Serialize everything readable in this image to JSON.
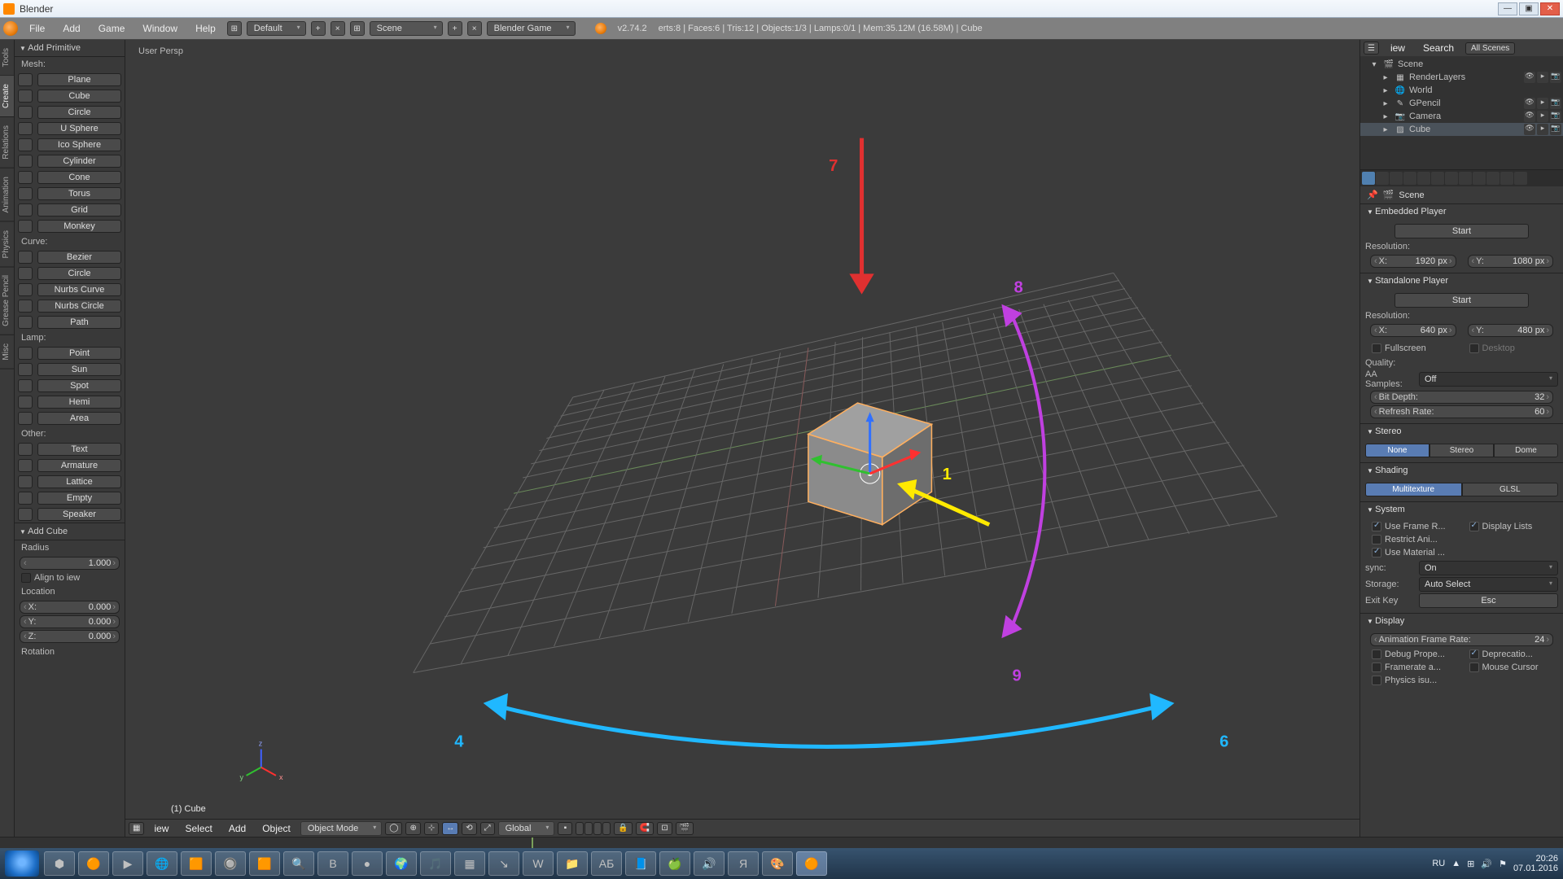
{
  "window": {
    "title": "Blender",
    "min": "—",
    "max": "▣",
    "close": "✕"
  },
  "header": {
    "menus": [
      "File",
      "Add",
      "Game",
      "Window",
      "Help"
    ],
    "layout": "Default",
    "scene": "Scene",
    "engine": "Blender Game",
    "version": "v2.74.2",
    "stats": "erts:8 | Faces:6 | Tris:12 | Objects:1/3 | Lamps:0/1 | Mem:35.12M (16.58M) | Cube"
  },
  "vtabs": [
    "Tools",
    "Create",
    "Relations",
    "Animation",
    "Physics",
    "Grease Pencil",
    "Misc"
  ],
  "toolshelf": {
    "title": "Add Primitive",
    "groups": [
      {
        "label": "Mesh:",
        "items": [
          "Plane",
          "Cube",
          "Circle",
          "U   Sphere",
          "Ico Sphere",
          "Cylinder",
          "Cone",
          "Torus",
          "Grid",
          "Monkey"
        ]
      },
      {
        "label": "Curve:",
        "items": [
          "Bezier",
          "Circle",
          "Nurbs Curve",
          "Nurbs Circle",
          "Path"
        ]
      },
      {
        "label": "Lamp:",
        "items": [
          "Point",
          "Sun",
          "Spot",
          "Hemi",
          "Area"
        ]
      },
      {
        "label": "Other:",
        "items": [
          "Text",
          "Armature",
          "Lattice",
          "Empty",
          "Speaker"
        ]
      }
    ],
    "operator": {
      "title": "Add Cube",
      "radius_l": "Radius",
      "radius_v": "1.000",
      "align": "Align to   iew",
      "loc_l": "Location",
      "x_l": "X:",
      "x_v": "0.000",
      "y_l": "Y:",
      "y_v": "0.000",
      "z_l": "Z:",
      "z_v": "0.000",
      "rot_l": "Rotation"
    }
  },
  "viewport": {
    "persp": "User Persp",
    "obj": "(1) Cube",
    "mode": "Object Mode",
    "orient": "Global",
    "menus": [
      "iew",
      "Select",
      "Add",
      "Object"
    ],
    "annotations": {
      "a1": "1",
      "a4": "4",
      "a6": "6",
      "a7": "7",
      "a8": "8",
      "a9": "9"
    }
  },
  "outliner": {
    "head": [
      "iew",
      "Search",
      "All Scenes"
    ],
    "rows": [
      {
        "ind": 0,
        "icon": "🎬",
        "name": "Scene",
        "sel": false,
        "toggles": false
      },
      {
        "ind": 1,
        "icon": "▦",
        "name": "RenderLayers",
        "sel": false,
        "toggles": true
      },
      {
        "ind": 1,
        "icon": "🌐",
        "name": "World",
        "sel": false,
        "toggles": false
      },
      {
        "ind": 1,
        "icon": "✎",
        "name": "GPencil",
        "sel": false,
        "toggles": true
      },
      {
        "ind": 1,
        "icon": "📷",
        "name": "Camera",
        "sel": false,
        "toggles": true
      },
      {
        "ind": 1,
        "icon": "▨",
        "name": "Cube",
        "sel": true,
        "toggles": true
      }
    ]
  },
  "props": {
    "breadcrumb": "Scene",
    "embedded_t": "Embedded Player",
    "start": "Start",
    "res_l": "Resolution:",
    "ex_l": "X:",
    "ex_v": "1920 px",
    "ey_l": "Y:",
    "ey_v": "1080 px",
    "standalone_t": "Standalone Player",
    "sx_l": "X:",
    "sx_v": "640 px",
    "sy_l": "Y:",
    "sy_v": "480 px",
    "fullscreen": "Fullscreen",
    "desktop": "Desktop",
    "quality_l": "Quality:",
    "aa_l": "AA Samples:",
    "aa_v": "Off",
    "bit_l": "Bit Depth:",
    "bit_v": "32",
    "refresh_l": "Refresh Rate:",
    "refresh_v": "60",
    "stereo_t": "Stereo",
    "stereo_opts": [
      "None",
      "Stereo",
      "Dome"
    ],
    "shading_t": "Shading",
    "shading_opts": [
      "Multitexture",
      "GLSL"
    ],
    "system_t": "System",
    "sys_chk": [
      "Use Frame R...",
      "Display Lists",
      "Restrict Ani...",
      "",
      "Use Material ...",
      ""
    ],
    "sync_l": "sync:",
    "sync_v": "On",
    "storage_l": "Storage:",
    "storage_v": "Auto Select",
    "exit_l": "Exit Key",
    "exit_v": "Esc",
    "display_t": "Display",
    "afr_l": "Animation Frame Rate:",
    "afr_v": "24",
    "disp_chk": [
      "Debug Prope...",
      "Deprecatio...",
      "Framerate a...",
      "Mouse Cursor",
      "Physics   isu..."
    ]
  },
  "taskbar": {
    "lang": "RU",
    "time": "20:26",
    "date": "07.01.2016",
    "icons": [
      "⬢",
      "🟠",
      "▶",
      "🌐",
      "🟧",
      "🔘",
      "🟧",
      "🔍",
      "В",
      "●",
      "🌍",
      "🎵",
      "▦",
      "↘",
      "W",
      "📁",
      "AБ",
      "📘",
      "🍏",
      "🔊",
      "Я",
      "🎨",
      "🟠"
    ]
  }
}
